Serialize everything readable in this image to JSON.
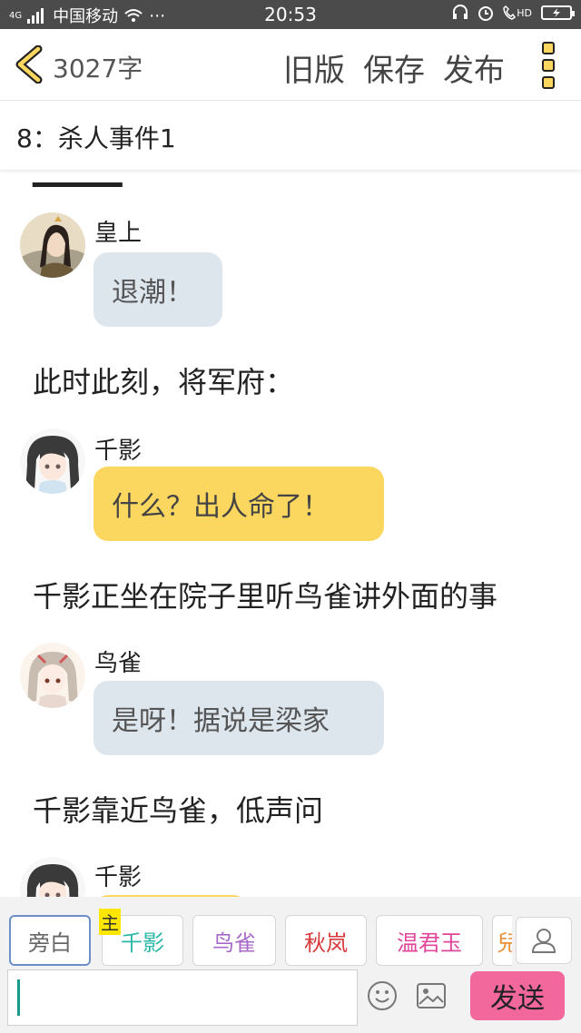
{
  "status": {
    "network": "4G",
    "carrier": "中国移动",
    "time": "20:53",
    "hd": "HD"
  },
  "header": {
    "word_count": "3027字",
    "old_version": "旧版",
    "save": "保存",
    "publish": "发布"
  },
  "chapter": {
    "title": "8：杀人事件1"
  },
  "messages": [
    {
      "speaker": "皇上",
      "text": "退潮！"
    },
    {
      "narration": "此时此刻，将军府："
    },
    {
      "speaker": "千影",
      "text": "什么？出人命了！"
    },
    {
      "narration": "千影正坐在院子里听鸟雀讲外面的事"
    },
    {
      "speaker": "鸟雀",
      "text": "是呀！据说是梁家"
    },
    {
      "narration": "千影靠近鸟雀，低声问"
    },
    {
      "speaker": "千影"
    }
  ],
  "roles": [
    {
      "label": "旁白",
      "color": "#666666"
    },
    {
      "label": "千影",
      "color": "#2bb7a8",
      "badge": "主"
    },
    {
      "label": "鸟雀",
      "color": "#a769c9"
    },
    {
      "label": "秋岚",
      "color": "#d9393a"
    },
    {
      "label": "温君玉",
      "color": "#e0459a"
    },
    {
      "label": "兒",
      "color": "#e8923a"
    }
  ],
  "composer": {
    "send": "发送"
  }
}
